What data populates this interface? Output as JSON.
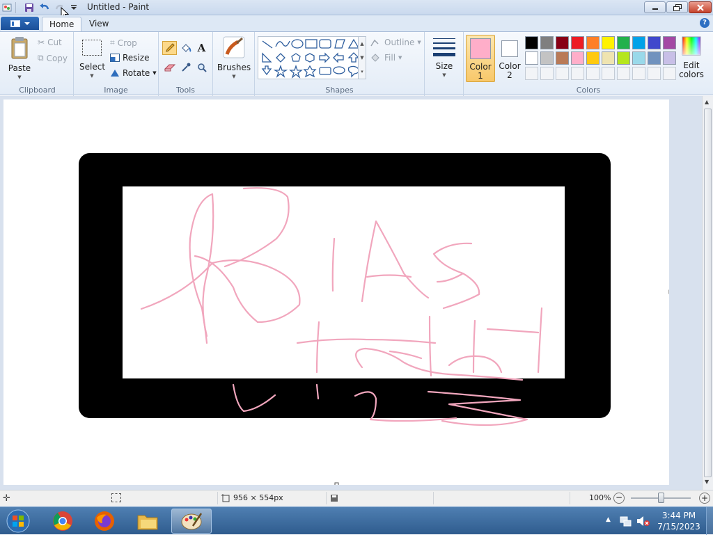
{
  "window": {
    "title": "Untitled - Paint"
  },
  "tabs": [
    {
      "label": "Home"
    },
    {
      "label": "View"
    }
  ],
  "clipboard": {
    "paste": "Paste",
    "cut": "Cut",
    "copy": "Copy",
    "group_label": "Clipboard"
  },
  "image": {
    "select": "Select",
    "crop": "Crop",
    "resize": "Resize",
    "rotate": "Rotate",
    "group_label": "Image"
  },
  "tools": {
    "group_label": "Tools"
  },
  "brushes": {
    "label": "Brushes"
  },
  "shapes": {
    "outline": "Outline",
    "fill": "Fill",
    "group_label": "Shapes"
  },
  "size": {
    "label": "Size"
  },
  "colors": {
    "color1_line1": "Color",
    "color1_line2": "1",
    "color1_value": "#ffaec9",
    "color2_line1": "Color",
    "color2_line2": "2",
    "color2_value": "#ffffff",
    "edit_line1": "Edit",
    "edit_line2": "colors",
    "group_label": "Colors",
    "palette_row1": [
      "#000000",
      "#7f7f7f",
      "#880015",
      "#ed1c24",
      "#ff7f27",
      "#fff200",
      "#22b14c",
      "#00a2e8",
      "#3f48cc",
      "#a349a4"
    ],
    "palette_row2": [
      "#ffffff",
      "#c3c3c3",
      "#b97a57",
      "#ffaec9",
      "#ffc90e",
      "#efe4b0",
      "#b5e61d",
      "#99d9ea",
      "#7092be",
      "#c8bfe7"
    ]
  },
  "status": {
    "image_size": "956 × 554px",
    "zoom": "100%"
  },
  "taskbar": {
    "time": "3:44 PM",
    "date": "7/15/2023"
  }
}
